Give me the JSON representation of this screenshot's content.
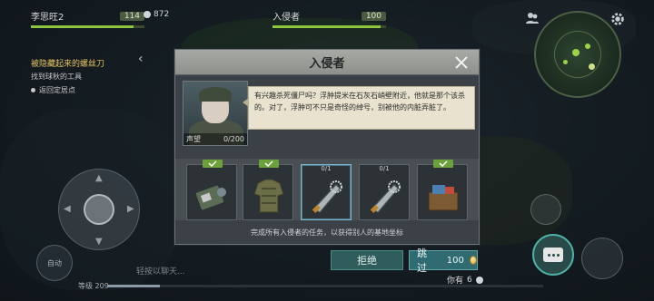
{
  "player": {
    "name": "李思旺2",
    "level": "114",
    "power": "872",
    "hp_fraction": 0.9
  },
  "enemy": {
    "name": "入侵者",
    "level": "100",
    "hp_fraction": 0.95
  },
  "quest": {
    "title": "被隐藏起来的螺丝刀",
    "subtitle": "找到球秋的工具",
    "back": "返回定居点"
  },
  "auto_label": "自动",
  "chat_placeholder": "轻按以聊天...",
  "level_label": "等级 209",
  "owned": {
    "label": "你有",
    "count": "6"
  },
  "dialog": {
    "title": "入侵者",
    "npc_label": "声望",
    "npc_progress": "0/200",
    "speech": "有兴趣杀死僵尸吗？浮肿提米在石灰石峭壁附近，他就是那个该杀的。对了，浮肿可不只是奇怪的绰号，别被他的内脏弄脏了。",
    "items": [
      {
        "status": "check",
        "icon": "id-card-icon"
      },
      {
        "status": "check",
        "icon": "armor-jacket-icon"
      },
      {
        "status": "0/1",
        "icon": "saw-blade-machete-icon"
      },
      {
        "status": "0/1",
        "icon": "saw-blade-machete-icon"
      },
      {
        "status": "check",
        "icon": "supply-crate-icon"
      }
    ],
    "footer": "完成所有入侵者的任务，以获得别人的基地坐标"
  },
  "buttons": {
    "reject": "拒绝",
    "skip": "跳过",
    "skip_cost": "100"
  },
  "colors": {
    "accent": "#2f6b71",
    "check": "#6da23a",
    "quest": "#e6c463"
  }
}
